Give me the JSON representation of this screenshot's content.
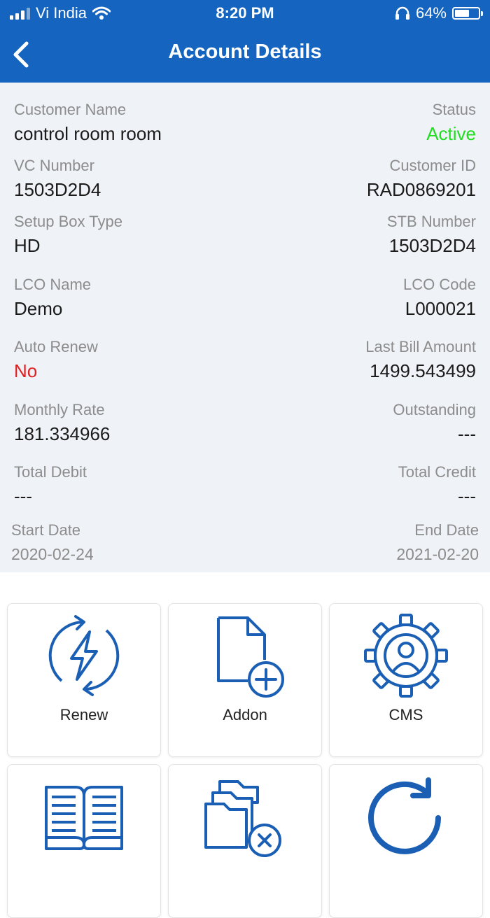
{
  "status_bar": {
    "carrier": "Vi India",
    "time": "8:20 PM",
    "battery_percent": "64%",
    "battery_level": 0.64,
    "icons": [
      "signal-icon",
      "wifi-icon",
      "headphones-icon",
      "battery-icon"
    ]
  },
  "header": {
    "title": "Account Details",
    "back_icon": "chevron-left-icon",
    "background": "#1464c0"
  },
  "details": {
    "customer_name_label": "Customer Name",
    "customer_name": "control room room",
    "status_label": "Status",
    "status": "Active",
    "status_color": "#22dd22",
    "vc_number_label": "VC Number",
    "vc_number": "1503D2D4",
    "customer_id_label": "Customer ID",
    "customer_id": "RAD0869201",
    "setup_box_type_label": "Setup Box Type",
    "setup_box_type": "HD",
    "stb_number_label": "STB Number",
    "stb_number": "1503D2D4",
    "lco_name_label": "LCO Name",
    "lco_name": "Demo",
    "lco_code_label": "LCO Code",
    "lco_code": "L000021",
    "auto_renew_label": "Auto Renew",
    "auto_renew": "No",
    "auto_renew_color": "#e02020",
    "last_bill_amount_label": "Last Bill Amount",
    "last_bill_amount": "1499.543499",
    "monthly_rate_label": "Monthly Rate",
    "monthly_rate": "181.334966",
    "outstanding_label": "Outstanding",
    "outstanding": "---",
    "total_debit_label": "Total Debit",
    "total_debit": "---",
    "total_credit_label": "Total Credit",
    "total_credit": "---",
    "start_date_label": "Start Date",
    "start_date": "2020-02-24",
    "end_date_label": "End Date",
    "end_date": "2021-02-20"
  },
  "actions": [
    {
      "label": "Renew",
      "icon": "renew-lightning-icon"
    },
    {
      "label": "Addon",
      "icon": "add-document-icon"
    },
    {
      "label": "CMS",
      "icon": "gear-user-icon"
    },
    {
      "label": "",
      "icon": "open-book-icon"
    },
    {
      "label": "",
      "icon": "folder-remove-icon"
    },
    {
      "label": "",
      "icon": "refresh-icon"
    }
  ],
  "accent_color": "#1a5fb4"
}
